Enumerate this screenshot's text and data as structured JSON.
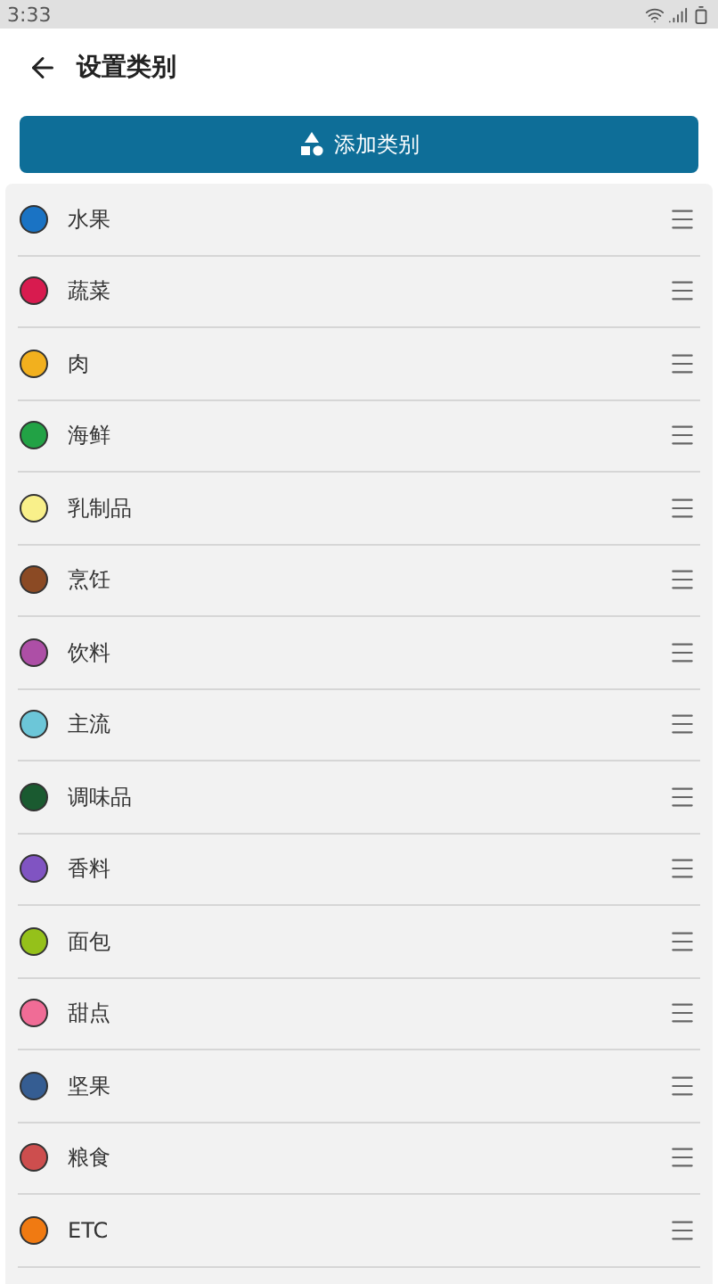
{
  "status_bar": {
    "time": "3:33"
  },
  "app_bar": {
    "title": "设置类别"
  },
  "add_button": {
    "label": "添加类别"
  },
  "categories": [
    {
      "name": "水果",
      "color": "#1a73c4"
    },
    {
      "name": "蔬菜",
      "color": "#d81b4f"
    },
    {
      "name": "肉",
      "color": "#f2b01e"
    },
    {
      "name": "海鲜",
      "color": "#22a245"
    },
    {
      "name": "乳制品",
      "color": "#f9f08a"
    },
    {
      "name": "烹饪",
      "color": "#8b4a24"
    },
    {
      "name": "饮料",
      "color": "#ad4fa6"
    },
    {
      "name": "主流",
      "color": "#6cc6d8"
    },
    {
      "name": "调味品",
      "color": "#1a5a30"
    },
    {
      "name": "香料",
      "color": "#8054c2"
    },
    {
      "name": "面包",
      "color": "#95c11a"
    },
    {
      "name": "甜点",
      "color": "#f06c96"
    },
    {
      "name": "坚果",
      "color": "#355d92"
    },
    {
      "name": "粮食",
      "color": "#cd4e4e"
    },
    {
      "name": "ETC",
      "color": "#f07a12"
    }
  ]
}
